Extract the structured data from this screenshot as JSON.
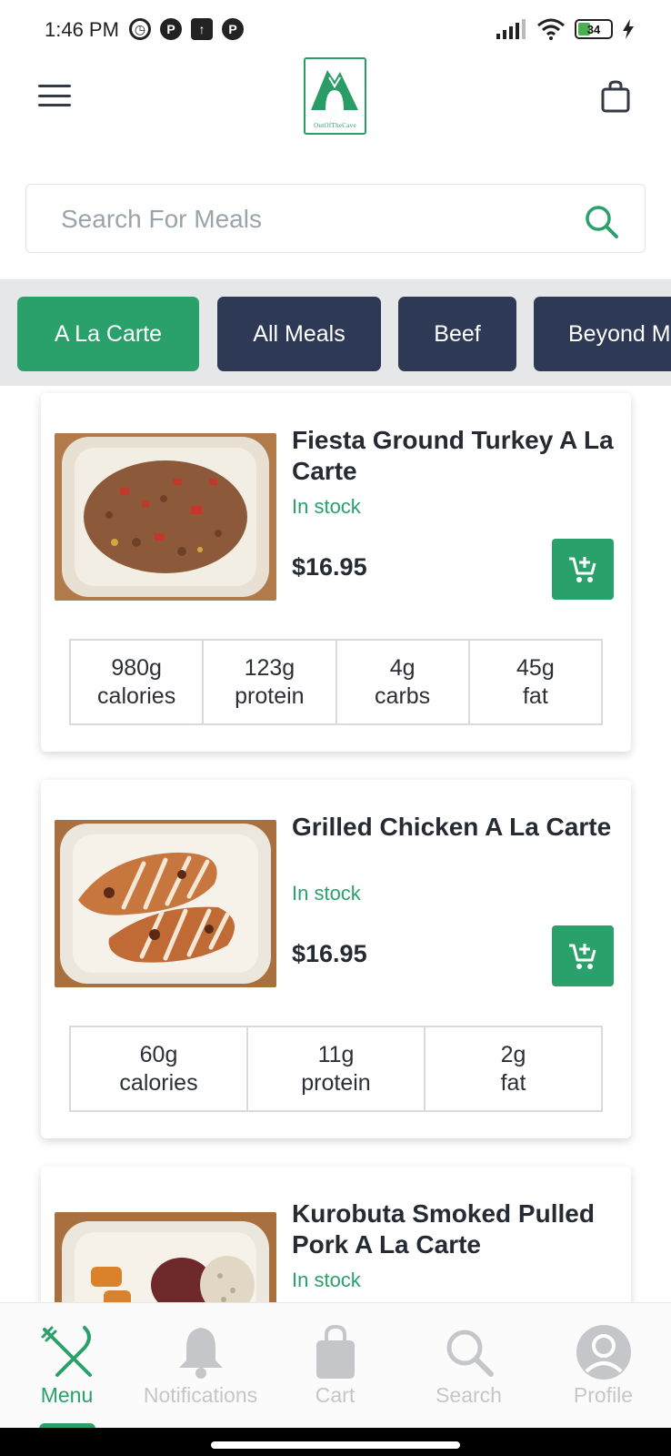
{
  "status_bar": {
    "time": "1:46 PM",
    "battery": "34"
  },
  "header": {
    "logo_text": "OutOfTheCave"
  },
  "search": {
    "placeholder": "Search For Meals"
  },
  "categories": [
    {
      "label": "A La Carte",
      "active": true
    },
    {
      "label": "All Meals",
      "active": false
    },
    {
      "label": "Beef",
      "active": false
    },
    {
      "label": "Beyond M",
      "active": false
    }
  ],
  "products": [
    {
      "name": "Fiesta Ground Turkey A La Carte",
      "stock": "In stock",
      "price": "$16.95",
      "macros": [
        {
          "value": "980g",
          "label": "calories"
        },
        {
          "value": "123g",
          "label": "protein"
        },
        {
          "value": "4g",
          "label": "carbs"
        },
        {
          "value": "45g",
          "label": "fat"
        }
      ]
    },
    {
      "name": "Grilled Chicken A La Carte",
      "stock": "In stock",
      "price": "$16.95",
      "macros": [
        {
          "value": "60g",
          "label": "calories"
        },
        {
          "value": "11g",
          "label": "protein"
        },
        {
          "value": "2g",
          "label": "fat"
        }
      ]
    },
    {
      "name": "Kurobuta Smoked Pulled Pork A La Carte",
      "stock": "In stock"
    }
  ],
  "bottom_nav": [
    {
      "label": "Menu",
      "icon": "fork-knife-icon",
      "active": true
    },
    {
      "label": "Notifications",
      "icon": "bell-icon",
      "active": false
    },
    {
      "label": "Cart",
      "icon": "shopping-bag-icon",
      "active": false
    },
    {
      "label": "Search",
      "icon": "search-icon",
      "active": false
    },
    {
      "label": "Profile",
      "icon": "user-avatar-icon",
      "active": false
    }
  ],
  "colors": {
    "brand_green": "#2aa06a",
    "tab_navy": "#2e3a55",
    "muted": "#c4c6c9"
  }
}
